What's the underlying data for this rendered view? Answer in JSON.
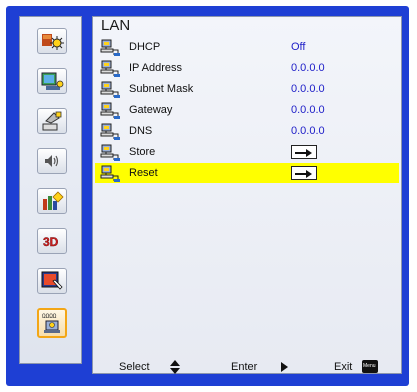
{
  "section": {
    "title": "LAN"
  },
  "sidebar": {
    "items": [
      {
        "name": "picture-icon"
      },
      {
        "name": "display-icon"
      },
      {
        "name": "settings-icon"
      },
      {
        "name": "volume-icon"
      },
      {
        "name": "options-icon"
      },
      {
        "name": "3d-icon",
        "label": "3D"
      },
      {
        "name": "interactive-icon"
      },
      {
        "name": "lan-icon",
        "selected": true
      }
    ]
  },
  "rows": [
    {
      "label": "DHCP",
      "value": "Off"
    },
    {
      "label": "IP Address",
      "value": "0.0.0.0"
    },
    {
      "label": "Subnet Mask",
      "value": "0.0.0.0"
    },
    {
      "label": "Gateway",
      "value": "0.0.0.0"
    },
    {
      "label": "DNS",
      "value": "0.0.0.0"
    },
    {
      "label": "Store",
      "value": null,
      "action": "enter-arrow-icon"
    },
    {
      "label": "Reset",
      "value": null,
      "action": "enter-arrow-icon",
      "highlighted": true
    }
  ],
  "footer": {
    "select_label": "Select",
    "enter_label": "Enter",
    "exit_label": "Exit",
    "menu_key_label": "Menu"
  },
  "colors": {
    "frame": "#1e3fd4",
    "highlight": "#ffff00",
    "value_text": "#2020c8"
  }
}
